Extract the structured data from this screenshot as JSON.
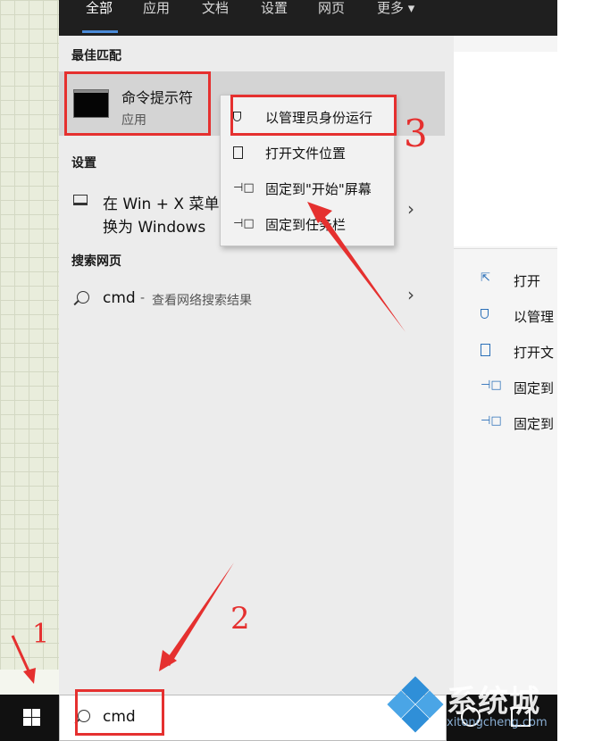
{
  "tabs": [
    {
      "label": "全部",
      "active": true
    },
    {
      "label": "应用"
    },
    {
      "label": "文档"
    },
    {
      "label": "设置"
    },
    {
      "label": "网页"
    },
    {
      "label": "更多 ▾"
    }
  ],
  "sections": {
    "best_match": "最佳匹配",
    "settings": "设置",
    "web": "搜索网页"
  },
  "best_match": {
    "title": "命令提示符",
    "subtitle": "应用"
  },
  "setting_item": {
    "line1": "在 Win + X 菜单",
    "line2": "换为 Windows"
  },
  "web_item": {
    "query": "cmd",
    "separator": "-",
    "hint": "查看网络搜索结果"
  },
  "context_menu": [
    {
      "icon": "shield-icon",
      "label": "以管理员身份运行"
    },
    {
      "icon": "file-location-icon",
      "label": "打开文件位置"
    },
    {
      "icon": "pin-icon",
      "label": "固定到\"开始\"屏幕"
    },
    {
      "icon": "pin-icon",
      "label": "固定到任务栏"
    }
  ],
  "preview_actions": [
    {
      "icon": "open-icon",
      "label": "打开"
    },
    {
      "icon": "shield-icon",
      "label": "以管理"
    },
    {
      "icon": "file-location-icon",
      "label": "打开文"
    },
    {
      "icon": "pin-icon",
      "label": "固定到"
    },
    {
      "icon": "pin-icon",
      "label": "固定到"
    }
  ],
  "search_box": {
    "value": "cmd"
  },
  "annotations": {
    "step1": "1",
    "step2": "2",
    "step3": "3",
    "color": "#e5302f"
  },
  "watermark": {
    "text": "系统城",
    "url": "xitongcheng.com"
  },
  "colors": {
    "accent": "#4a8ad8",
    "annotation": "#e5302f"
  }
}
